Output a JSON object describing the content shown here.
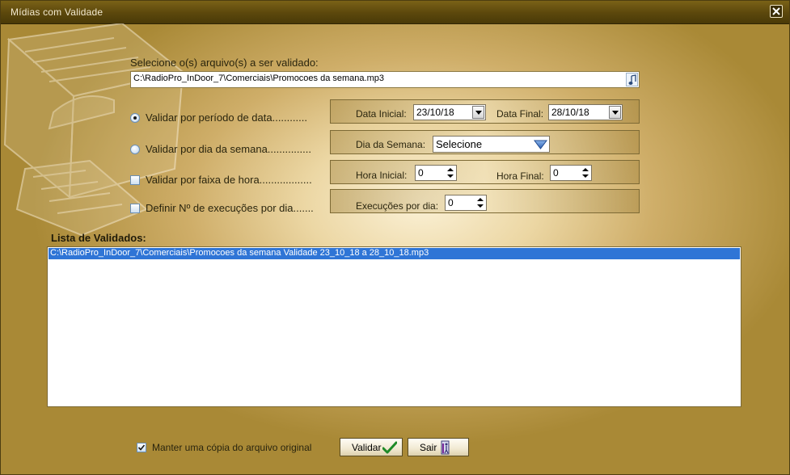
{
  "window": {
    "title": "Mídias com Validade"
  },
  "file": {
    "label": "Selecione o(s) arquivo(s) a ser validado:",
    "value": "C:\\RadioPro_InDoor_7\\Comerciais\\Promocoes da semana.mp3"
  },
  "options": [
    {
      "label": "Validar por período de data............",
      "type": "radio",
      "checked": true
    },
    {
      "label": "Validar por dia da semana...............",
      "type": "radio",
      "checked": false
    },
    {
      "label": "Validar por faixa de hora..................",
      "type": "checkbox",
      "checked": false
    },
    {
      "label": "Definir Nº de execuções por dia.......",
      "type": "checkbox",
      "checked": false
    }
  ],
  "date_panel": {
    "start_label": "Data Inicial:",
    "start_value": "23/10/18",
    "end_label": "Data Final:",
    "end_value": "28/10/18"
  },
  "weekday_panel": {
    "label": "Dia da Semana:",
    "value": "Selecione"
  },
  "hour_panel": {
    "start_label": "Hora Inicial:",
    "start_value": "0",
    "end_label": "Hora Final:",
    "end_value": "0"
  },
  "exec_panel": {
    "label": "Execuções por dia:",
    "value": "0"
  },
  "validated_list": {
    "title": "Lista de Validados:",
    "items": [
      "C:\\RadioPro_InDoor_7\\Comerciais\\Promocoes da semana Validade 23_10_18 a 28_10_18.mp3"
    ],
    "selected_color": "#2f75d6"
  },
  "keep_copy": {
    "label": "Manter uma cópia do arquivo original",
    "checked": true
  },
  "buttons": {
    "validate": "Validar",
    "exit": "Sair"
  },
  "colors": {
    "titlebar": "#5b470c",
    "background": "#d6b876",
    "selection": "#2f75d6"
  }
}
